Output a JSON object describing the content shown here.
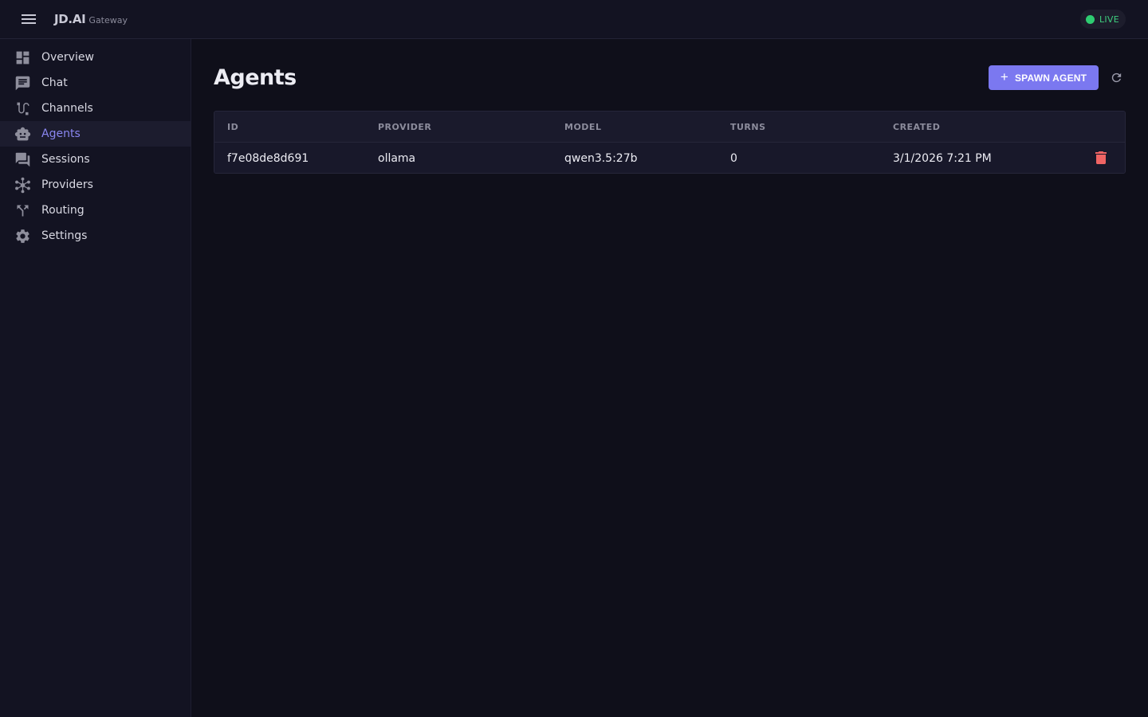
{
  "app": {
    "brand_name": "JD.AI",
    "brand_sub": "Gateway",
    "status_label": "LIVE",
    "status_color": "#2ecc71",
    "accent_color": "#7b78f0"
  },
  "sidebar": {
    "items": [
      {
        "label": "Overview",
        "icon": "dashboard-icon"
      },
      {
        "label": "Chat",
        "icon": "chat-icon"
      },
      {
        "label": "Channels",
        "icon": "channels-icon"
      },
      {
        "label": "Agents",
        "icon": "robot-icon",
        "active": true
      },
      {
        "label": "Sessions",
        "icon": "forum-icon"
      },
      {
        "label": "Providers",
        "icon": "hub-icon"
      },
      {
        "label": "Routing",
        "icon": "fork-icon"
      },
      {
        "label": "Settings",
        "icon": "gear-icon"
      }
    ]
  },
  "page": {
    "title": "Agents",
    "spawn_label": "SPAWN AGENT",
    "refresh_icon": "refresh-icon"
  },
  "table": {
    "columns": [
      "ID",
      "PROVIDER",
      "MODEL",
      "TURNS",
      "CREATED"
    ],
    "rows": [
      {
        "id": "f7e08de8d691",
        "provider": "ollama",
        "model": "qwen3.5:27b",
        "turns": "0",
        "created": "3/1/2026 7:21 PM",
        "action_icon": "trash-icon"
      }
    ]
  }
}
